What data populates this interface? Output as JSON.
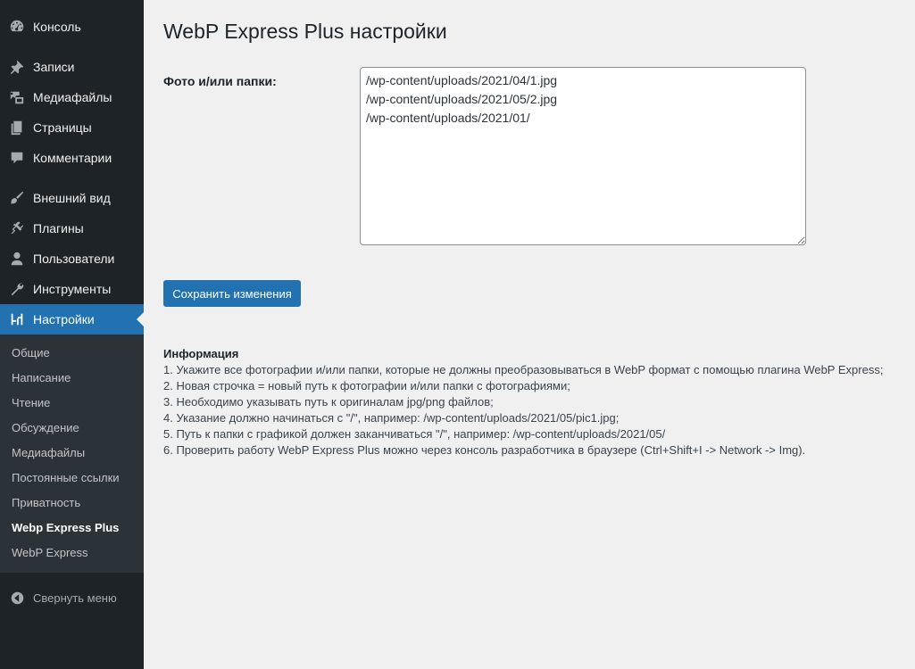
{
  "sidebar": {
    "menu": [
      {
        "label": "Консоль",
        "icon": "dashboard-icon"
      },
      {
        "label": "Записи",
        "icon": "pushpin-icon"
      },
      {
        "label": "Медиафайлы",
        "icon": "media-icon"
      },
      {
        "label": "Страницы",
        "icon": "pages-icon"
      },
      {
        "label": "Комментарии",
        "icon": "comment-icon"
      },
      {
        "label": "Внешний вид",
        "icon": "paintbrush-icon"
      },
      {
        "label": "Плагины",
        "icon": "plugin-icon"
      },
      {
        "label": "Пользователи",
        "icon": "user-icon"
      },
      {
        "label": "Инструменты",
        "icon": "wrench-icon"
      },
      {
        "label": "Настройки",
        "icon": "settings-icon",
        "active": true
      }
    ],
    "submenu": [
      {
        "label": "Общие"
      },
      {
        "label": "Написание"
      },
      {
        "label": "Чтение"
      },
      {
        "label": "Обсуждение"
      },
      {
        "label": "Медиафайлы"
      },
      {
        "label": "Постоянные ссылки"
      },
      {
        "label": "Приватность"
      },
      {
        "label": "Webp Express Plus",
        "current": true
      },
      {
        "label": "WebP Express"
      }
    ],
    "collapse_label": "Свернуть меню"
  },
  "main": {
    "title": "WebP Express Plus настройки",
    "field_label": "Фото и/или папки:",
    "textarea_value": "/wp-content/uploads/2021/04/1.jpg\n/wp-content/uploads/2021/05/2.jpg\n/wp-content/uploads/2021/01/",
    "save_label": "Сохранить изменения",
    "info": {
      "title": "Информация",
      "lines": [
        "1. Укажите все фотографии и/или папки, которые не должны преобразовываться в WebP формат с помощью плагина WebP Express;",
        "2. Новая строчка = новый путь к фотографии и/или папки с фотографиями;",
        "3. Необходимо указывать путь к оригиналам jpg/png файлов;",
        "4. Указание должно начинаться с \"/\", например: /wp-content/uploads/2021/05/pic1.jpg;",
        "5. Путь к папки с графикой должен заканчиваться \"/\", например: /wp-content/uploads/2021/05/",
        "6. Проверить работу WebP Express Plus можно через консоль разработчика в браузере (Ctrl+Shift+I -> Network -> Img)."
      ]
    }
  },
  "colors": {
    "sidebar_bg": "#1d2327",
    "submenu_bg": "#2c3338",
    "accent": "#2271b1",
    "page_bg": "#f0f0f1"
  }
}
